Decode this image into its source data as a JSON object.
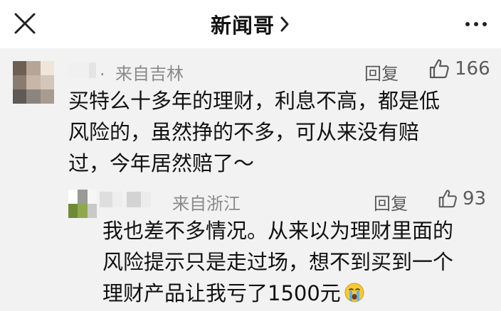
{
  "header": {
    "title": "新闻哥",
    "close_icon": "close-icon",
    "chevron_icon": "chevron-right-icon",
    "more_icon": "more-vertical-dots-icon"
  },
  "comments": [
    {
      "name_tail": ".",
      "location": "来自吉林",
      "reply_label": "回复",
      "like_count": "166",
      "text_lines": [
        "买特么十多年的理财，利息不高，都是低",
        "风险的，虽然挣的不多，可从来没有赔",
        "过，今年居然赔了～"
      ],
      "avatar_colors": [
        "#6e5f55",
        "#b7a597",
        "#efe6da",
        "#8a7b70",
        "#c8b6a8",
        "#d4c6b8",
        "#5f5a56",
        "#8c847e",
        "#a89b90"
      ]
    },
    {
      "name_tail": "",
      "location": "来自浙江",
      "reply_label": "回复",
      "like_count": "93",
      "text_lines": [
        "我也差不多情况。从来以为理财里面的",
        "风险提示只是走过场，想不到买到一个",
        "理财产品让我亏了1500元"
      ],
      "emoji": "crying-face-icon",
      "avatar_colors": [
        "#ffffff",
        "#9a9a96",
        "#f6f6f4",
        "#6f8a36",
        "#8fa84e",
        "#c9c9c7"
      ]
    }
  ],
  "colors": {
    "header_bg": "#ffffff",
    "content_bg": "#f2f2f2",
    "meta_text": "#8a8a8a",
    "action_text": "#5a5a5a",
    "body_text": "#111111"
  }
}
